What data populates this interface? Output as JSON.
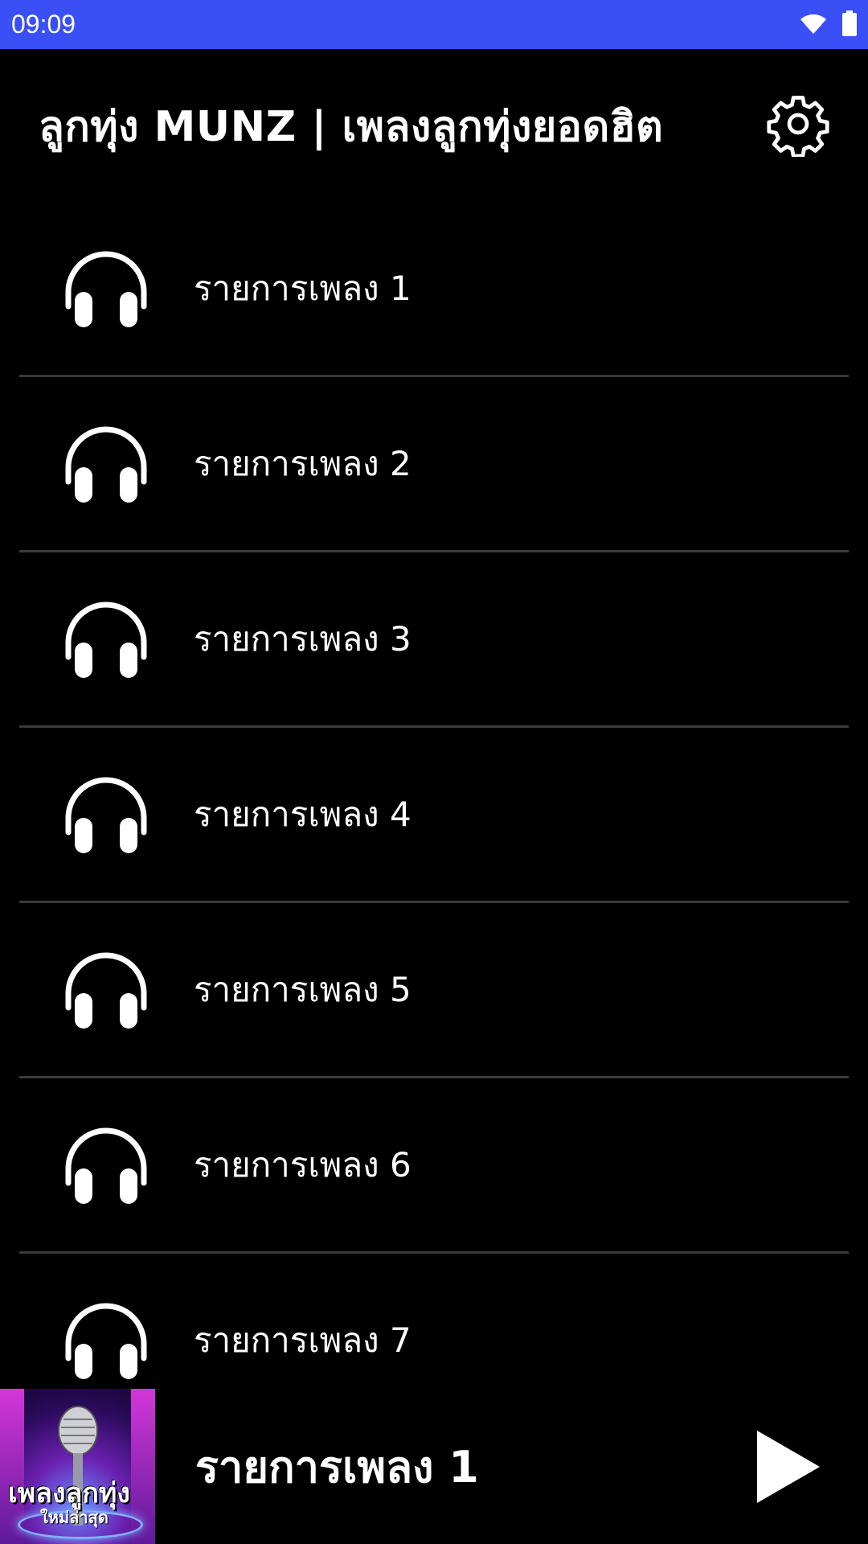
{
  "status_bar": {
    "time": "09:09",
    "icons": [
      "wifi-icon",
      "battery-icon"
    ],
    "background": "#3a4ff5"
  },
  "header": {
    "title": "ลูกทุ่ง MUNZ | เพลงลูกทุ่งยอดฮิต",
    "settings_icon": "gear-icon"
  },
  "playlist": {
    "items": [
      {
        "label": "รายการเพลง 1",
        "icon": "headphones-icon"
      },
      {
        "label": "รายการเพลง 2",
        "icon": "headphones-icon"
      },
      {
        "label": "รายการเพลง 3",
        "icon": "headphones-icon"
      },
      {
        "label": "รายการเพลง 4",
        "icon": "headphones-icon"
      },
      {
        "label": "รายการเพลง 5",
        "icon": "headphones-icon"
      },
      {
        "label": "รายการเพลง 6",
        "icon": "headphones-icon"
      },
      {
        "label": "รายการเพลง 7",
        "icon": "headphones-icon"
      }
    ]
  },
  "player": {
    "artwork_text_line1": "เพลงลูกทุ่ง",
    "artwork_text_line2": "ใหม่ล่าสุด",
    "title": "รายการเพลง 1",
    "play_icon": "play-icon"
  }
}
